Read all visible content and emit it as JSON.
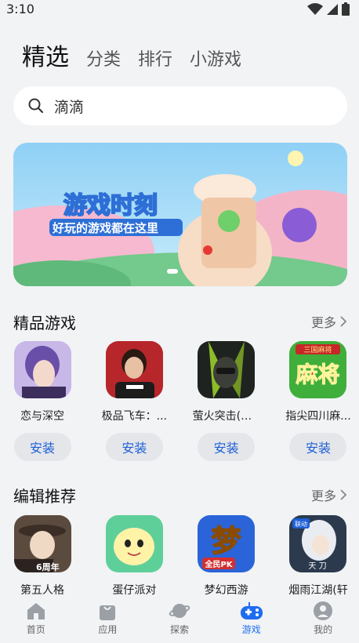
{
  "status": {
    "time": "3:10"
  },
  "tabs": [
    {
      "label": "精选",
      "active": true
    },
    {
      "label": "分类",
      "active": false
    },
    {
      "label": "排行",
      "active": false
    },
    {
      "label": "小游戏",
      "active": false
    }
  ],
  "search": {
    "value": "滴滴"
  },
  "banner": {
    "title": "游戏时刻",
    "subtitle": "好玩的游戏都在这里"
  },
  "featured": {
    "title": "精品游戏",
    "more": "更多",
    "apps": [
      {
        "name": "恋与深空",
        "install": "安装"
      },
      {
        "name": "极品飞车：...",
        "install": "安装"
      },
      {
        "name": "萤火突击(盛...",
        "install": "安装"
      },
      {
        "name": "指尖四川麻...",
        "install": "安装"
      }
    ]
  },
  "editor": {
    "title": "编辑推荐",
    "more": "更多",
    "apps": [
      {
        "name": "第五人格"
      },
      {
        "name": "蛋仔派对"
      },
      {
        "name": "梦幻西游"
      },
      {
        "name": "烟雨江湖(轩"
      }
    ]
  },
  "icon_text": {
    "idv_badge": "6周年",
    "mj_top": "三国麻将",
    "mj_main": "麻将",
    "mhxy_main": "梦",
    "mhxy_sub": "全民PK",
    "yy_badge": "联动",
    "yy_text": "天 刀"
  },
  "nav": [
    {
      "label": "首页",
      "active": false
    },
    {
      "label": "应用",
      "active": false
    },
    {
      "label": "探索",
      "active": false
    },
    {
      "label": "游戏",
      "active": true
    },
    {
      "label": "我的",
      "active": false
    }
  ],
  "colors": {
    "accent": "#1e6df0",
    "install_text": "#1e5fd6"
  }
}
